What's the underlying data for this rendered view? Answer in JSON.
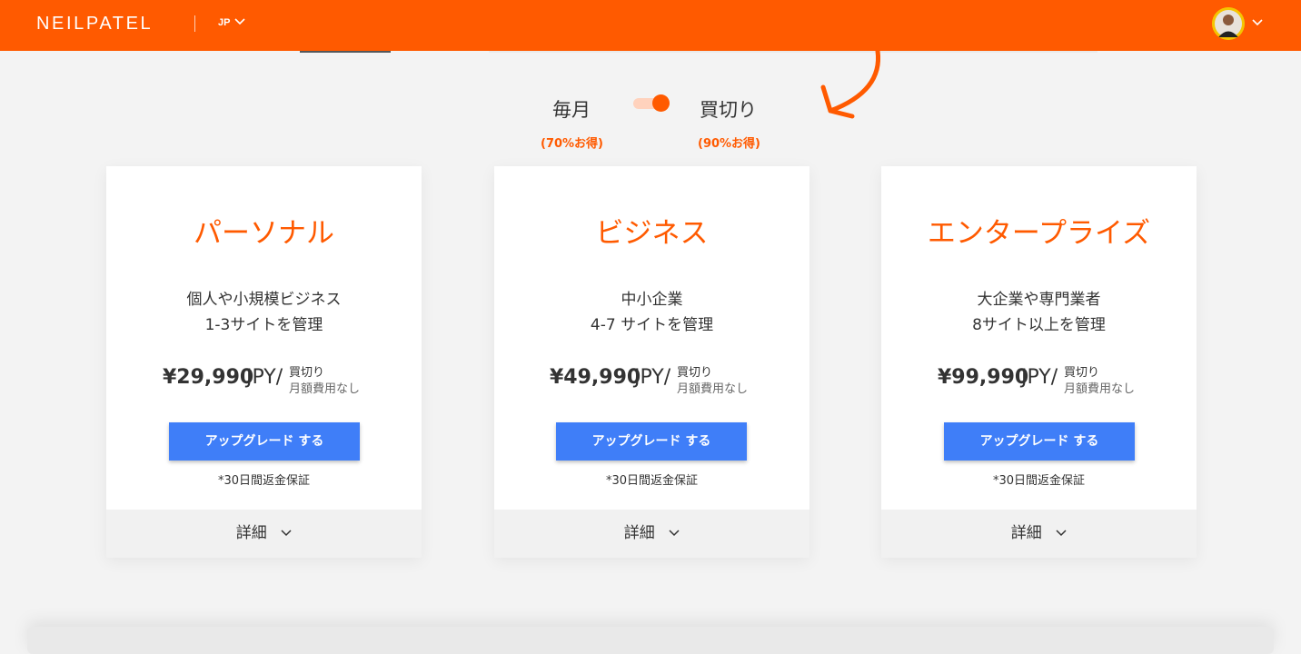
{
  "header": {
    "logo": "NEILPATEL",
    "language": "JP"
  },
  "toggle": {
    "monthly_label": "毎月",
    "monthly_savings": "(70%お得)",
    "onetime_label": "買切り",
    "onetime_savings": "(90%お得)",
    "selected": "onetime"
  },
  "plans": [
    {
      "name": "パーソナル",
      "desc_line1": "個人や小規模ビジネス",
      "desc_line2": "1-3サイトを管理",
      "price": "¥29,990",
      "unit": "JPY/",
      "term": "買切り",
      "note": "月額費用なし",
      "button": "アップグレード する",
      "guarantee": "*30日間返金保証",
      "details": "詳細"
    },
    {
      "name": "ビジネス",
      "desc_line1": "中小企業",
      "desc_line2": "4-7 サイトを管理",
      "price": "¥49,990",
      "unit": "JPY/",
      "term": "買切り",
      "note": "月額費用なし",
      "button": "アップグレード する",
      "guarantee": "*30日間返金保証",
      "details": "詳細"
    },
    {
      "name": "エンタープライズ",
      "desc_line1": "大企業や専門業者",
      "desc_line2": "8サイト以上を管理",
      "price": "¥99,990",
      "unit": "JPY/",
      "term": "買切り",
      "note": "月額費用なし",
      "button": "アップグレード する",
      "guarantee": "*30日間返金保証",
      "details": "詳細"
    }
  ],
  "colors": {
    "brand": "#ff5a00",
    "button": "#3f7ef8"
  }
}
